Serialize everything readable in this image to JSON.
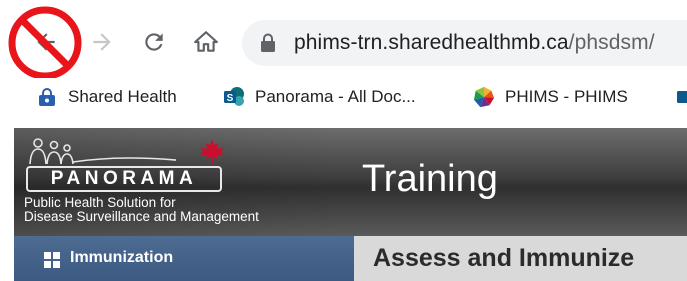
{
  "browser": {
    "url_host": "phims-trn.sharedhealthmb.ca",
    "url_path": "/phsdsm/"
  },
  "bookmarks": [
    {
      "label": "Shared Health",
      "icon": "lock-padlock-icon"
    },
    {
      "label": "Panorama - All Doc...",
      "icon": "sharepoint-icon"
    },
    {
      "label": "PHIMS - PHIMS",
      "icon": "phims-pinwheel-icon"
    }
  ],
  "app": {
    "logo_word": "PANORAMA",
    "tagline_line1": "Public Health Solution for",
    "tagline_line2": "Disease Surveillance and Management",
    "environment": "Training",
    "module_tab": "Immunization",
    "page_title": "Assess and Immunize"
  },
  "colors": {
    "stop_sign_red": "#e8151b",
    "module_tab_blue": "#3f5d86",
    "page_title_bg": "#d9d9d9",
    "maple_red": "#c8102e"
  }
}
